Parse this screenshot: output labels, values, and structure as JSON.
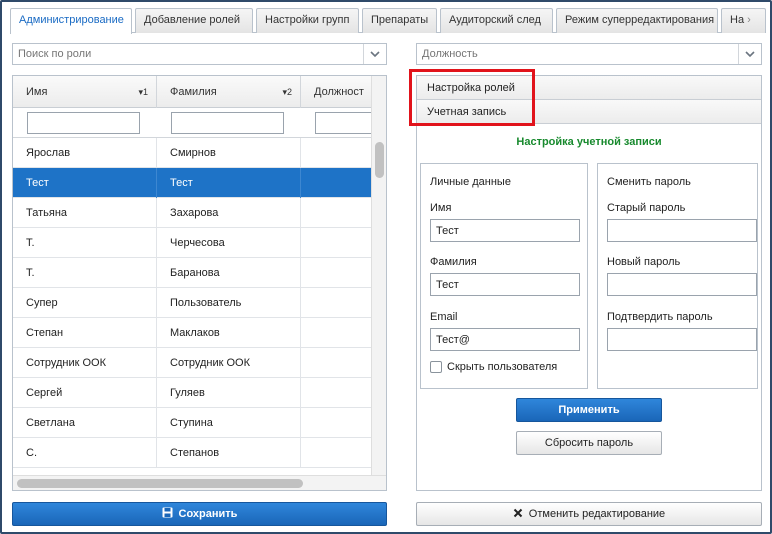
{
  "tabs": [
    {
      "label": "Администрирование",
      "active": true
    },
    {
      "label": "Добавление ролей"
    },
    {
      "label": "Настройки групп"
    },
    {
      "label": "Препараты"
    },
    {
      "label": "Аудиторский след"
    },
    {
      "label": "Режим суперредактирования"
    },
    {
      "label": "На"
    }
  ],
  "role_search": {
    "placeholder": "Поиск по роли"
  },
  "position_select": {
    "placeholder": "Должность"
  },
  "grid": {
    "columns": [
      {
        "label": "Имя",
        "sort": "▾1"
      },
      {
        "label": "Фамилия",
        "sort": "▾2"
      },
      {
        "label": "Должност"
      }
    ],
    "rows": [
      {
        "first": "Ярослав",
        "last": "Смирнов"
      },
      {
        "first": "Тест",
        "last": "Тест",
        "selected": true
      },
      {
        "first": "Татьяна",
        "last": "Захарова"
      },
      {
        "first": "Т.",
        "last": "Черчесова"
      },
      {
        "first": "Т.",
        "last": "Баранова"
      },
      {
        "first": "Супер",
        "last": "Пользователь"
      },
      {
        "first": "Степан",
        "last": "Маклаков"
      },
      {
        "first": "Сотрудник ООК",
        "last": "Сотрудник ООК"
      },
      {
        "first": "Сергей",
        "last": "Гуляев"
      },
      {
        "first": "Светлана",
        "last": "Ступина"
      },
      {
        "first": "С.",
        "last": "Степанов"
      }
    ]
  },
  "save_button": {
    "label": "Сохранить",
    "icon": "save-icon"
  },
  "accordion": {
    "items": [
      "Настройка ролей",
      "Учетная запись"
    ]
  },
  "account": {
    "title": "Настройка учетной записи",
    "title_color": "#188a2e",
    "personal": {
      "title": "Личные данные",
      "first_label": "Имя",
      "first_value": "Тест",
      "last_label": "Фамилия",
      "last_value": "Тест",
      "email_label": "Email",
      "email_value": "Тест@",
      "hide_label": "Скрыть пользователя"
    },
    "password": {
      "title": "Сменить пароль",
      "old_label": "Старый пароль",
      "new_label": "Новый пароль",
      "confirm_label": "Подтвердить пароль"
    },
    "apply_label": "Применить",
    "reset_label": "Сбросить пароль"
  },
  "cancel_button": {
    "label": "Отменить редактирование",
    "icon": "close-icon"
  },
  "colors": {
    "accent": "#1e73c7",
    "highlight": "#e1131b"
  }
}
